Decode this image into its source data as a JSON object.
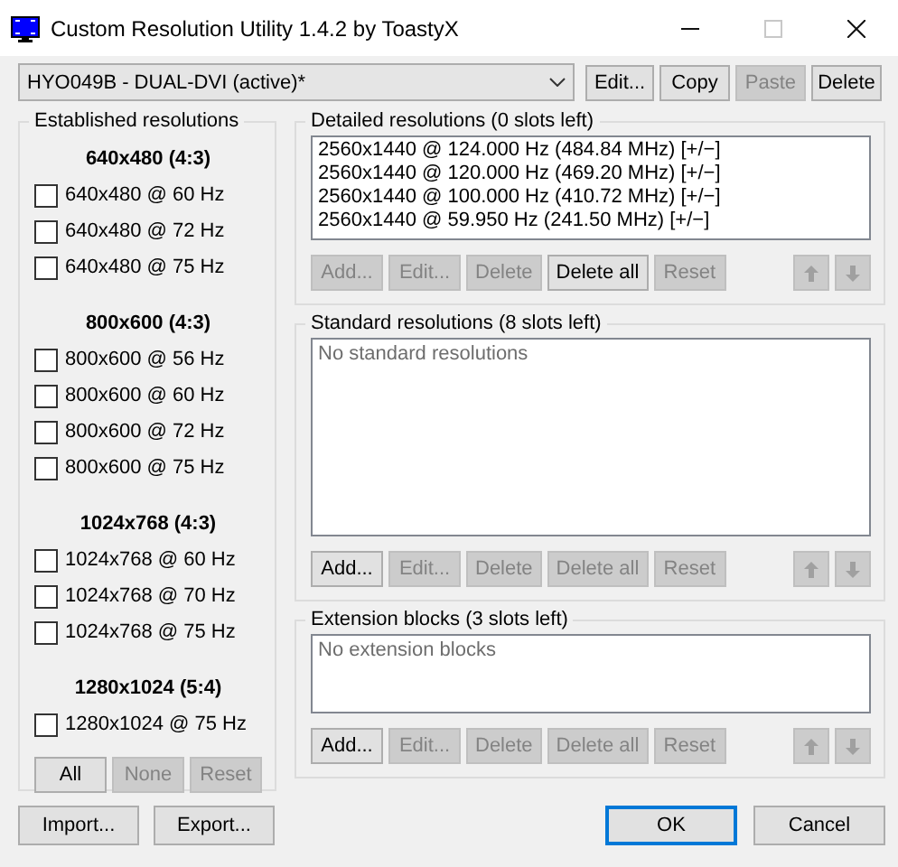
{
  "window": {
    "title": "Custom Resolution Utility 1.4.2 by ToastyX",
    "controls": [
      {
        "kind": "minimize",
        "disabled": false
      },
      {
        "kind": "maximize",
        "disabled": true
      },
      {
        "kind": "close",
        "disabled": false
      }
    ]
  },
  "device": {
    "value": "HYO049B - DUAL-DVI (active)*",
    "buttons": [
      {
        "label": "Edit...",
        "disabled": false
      },
      {
        "label": "Copy",
        "disabled": false
      },
      {
        "label": "Paste",
        "disabled": true
      },
      {
        "label": "Delete",
        "disabled": false
      }
    ]
  },
  "established": {
    "title": "Established resolutions",
    "groups": [
      {
        "heading": "640x480 (4:3)",
        "items": [
          {
            "label": "640x480 @ 60 Hz",
            "checked": false
          },
          {
            "label": "640x480 @ 72 Hz",
            "checked": false
          },
          {
            "label": "640x480 @ 75 Hz",
            "checked": false
          }
        ]
      },
      {
        "heading": "800x600 (4:3)",
        "items": [
          {
            "label": "800x600 @ 56 Hz",
            "checked": false
          },
          {
            "label": "800x600 @ 60 Hz",
            "checked": false
          },
          {
            "label": "800x600 @ 72 Hz",
            "checked": false
          },
          {
            "label": "800x600 @ 75 Hz",
            "checked": false
          }
        ]
      },
      {
        "heading": "1024x768 (4:3)",
        "items": [
          {
            "label": "1024x768 @ 60 Hz",
            "checked": false
          },
          {
            "label": "1024x768 @ 70 Hz",
            "checked": false
          },
          {
            "label": "1024x768 @ 75 Hz",
            "checked": false
          }
        ]
      },
      {
        "heading": "1280x1024 (5:4)",
        "items": [
          {
            "label": "1280x1024 @ 75 Hz",
            "checked": false
          }
        ]
      }
    ],
    "buttons": [
      {
        "label": "All",
        "disabled": false
      },
      {
        "label": "None",
        "disabled": true
      },
      {
        "label": "Reset",
        "disabled": true
      }
    ]
  },
  "sections": [
    {
      "title": "Detailed resolutions (0 slots left)",
      "items": [
        "2560x1440 @ 124.000 Hz (484.84 MHz) [+/−]",
        "2560x1440 @ 120.000 Hz (469.20 MHz) [+/−]",
        "2560x1440 @ 100.000 Hz (410.72 MHz) [+/−]",
        "2560x1440 @ 59.950 Hz (241.50 MHz) [+/−]"
      ],
      "buttons": [
        {
          "label": "Add...",
          "disabled": true
        },
        {
          "label": "Edit...",
          "disabled": true
        },
        {
          "label": "Delete",
          "disabled": true
        },
        {
          "label": "Delete all",
          "disabled": false
        },
        {
          "label": "Reset",
          "disabled": true
        }
      ],
      "move_buttons": [
        {
          "kind": "up",
          "disabled": true
        },
        {
          "kind": "down",
          "disabled": true
        }
      ]
    },
    {
      "title": "Standard resolutions (8 slots left)",
      "empty_text": "No standard resolutions",
      "buttons": [
        {
          "label": "Add...",
          "disabled": false
        },
        {
          "label": "Edit...",
          "disabled": true
        },
        {
          "label": "Delete",
          "disabled": true
        },
        {
          "label": "Delete all",
          "disabled": true
        },
        {
          "label": "Reset",
          "disabled": true
        }
      ],
      "move_buttons": [
        {
          "kind": "up",
          "disabled": true
        },
        {
          "kind": "down",
          "disabled": true
        }
      ]
    },
    {
      "title": "Extension blocks (3 slots left)",
      "empty_text": "No extension blocks",
      "buttons": [
        {
          "label": "Add...",
          "disabled": false
        },
        {
          "label": "Edit...",
          "disabled": true
        },
        {
          "label": "Delete",
          "disabled": true
        },
        {
          "label": "Delete all",
          "disabled": true
        },
        {
          "label": "Reset",
          "disabled": true
        }
      ],
      "move_buttons": [
        {
          "kind": "up",
          "disabled": true
        },
        {
          "kind": "down",
          "disabled": true
        }
      ]
    }
  ],
  "footer": {
    "left": [
      {
        "label": "Import...",
        "default": false
      },
      {
        "label": "Export...",
        "default": false
      }
    ],
    "right": [
      {
        "label": "OK",
        "default": true
      },
      {
        "label": "Cancel",
        "default": false
      }
    ]
  }
}
